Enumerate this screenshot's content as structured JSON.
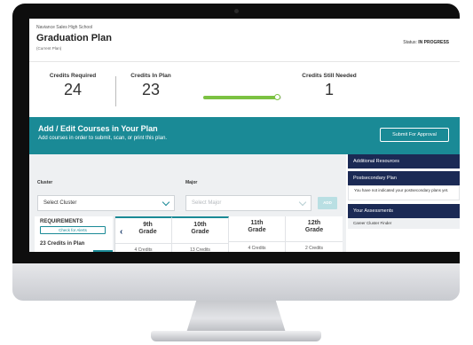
{
  "header": {
    "school": "Naviance Sales High School",
    "title": "Graduation Plan",
    "subtitle": "(Current Plan)",
    "status_label": "Status:",
    "status_value": "IN PROGRESS"
  },
  "credits": {
    "required_label": "Credits Required",
    "required_value": "24",
    "in_plan_label": "Credits In Plan",
    "in_plan_value": "23",
    "needed_label": "Credits Still Needed",
    "needed_value": "1",
    "progress_fraction": 0.96,
    "progress_color": "#7cc242"
  },
  "banner": {
    "title": "Add / Edit Courses in Your Plan",
    "subtitle": "Add courses in order to submit, scan, or print this plan.",
    "submit_label": "Submit For Approval",
    "color": "#1a8a96"
  },
  "filters": {
    "cluster_label": "Cluster",
    "cluster_value": "Select Cluster",
    "major_label": "Major",
    "major_placeholder": "Select Major",
    "add_label": "ADD"
  },
  "requirements": {
    "title": "REQUIREMENTS",
    "alerts_label": "Check for Alerts",
    "credits_text": "23 Credits in Plan"
  },
  "grades": [
    {
      "name_line1": "9th",
      "name_line2": "Grade",
      "credits": "4 Credits"
    },
    {
      "name_line1": "10th",
      "name_line2": "Grade",
      "credits": "13 Credits"
    },
    {
      "name_line1": "11th",
      "name_line2": "Grade",
      "credits": "4 Credits"
    },
    {
      "name_line1": "12th",
      "name_line2": "Grade",
      "credits": "2 Credits"
    }
  ],
  "sidebar": {
    "additional_resources": "Additional Resources",
    "postsecondary_plan": "Postsecondary Plan",
    "postsecondary_note": "You have not indicated your postsecondary plans yet.",
    "your_assessments": "Your Assessments",
    "career_cluster_finder": "Career Cluster Finder",
    "header_color": "#1b2a55"
  }
}
